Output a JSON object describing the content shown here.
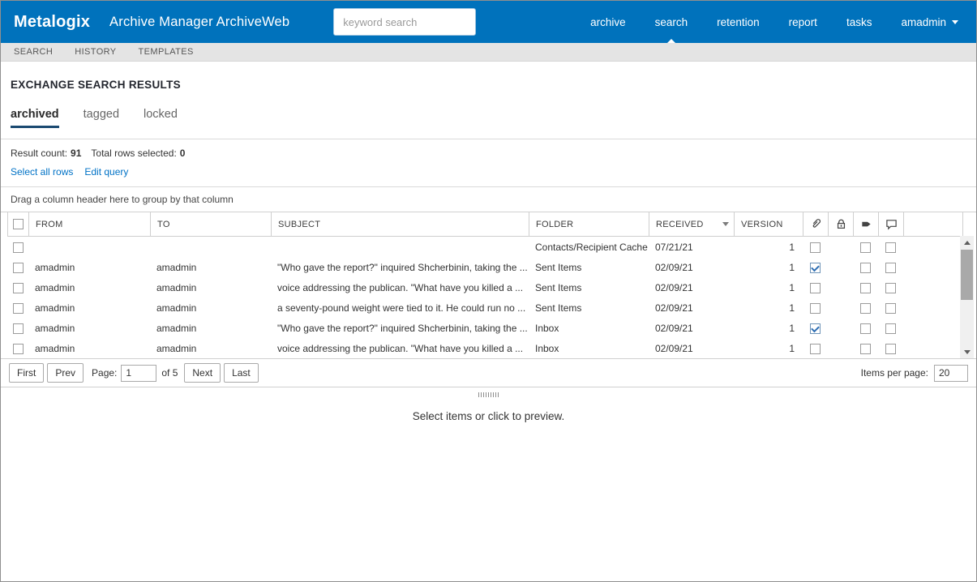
{
  "header": {
    "logo": "Metalogix",
    "app_title": "Archive Manager ArchiveWeb",
    "search": {
      "placeholder": "keyword search",
      "value": ""
    },
    "nav": [
      {
        "label": "archive",
        "active": false,
        "has_menu": false
      },
      {
        "label": "search",
        "active": true,
        "has_menu": false
      },
      {
        "label": "retention",
        "active": false,
        "has_menu": false
      },
      {
        "label": "report",
        "active": false,
        "has_menu": false
      },
      {
        "label": "tasks",
        "active": false,
        "has_menu": false
      },
      {
        "label": "amadmin",
        "active": false,
        "has_menu": true
      }
    ]
  },
  "subnav": {
    "items": [
      {
        "label": "SEARCH"
      },
      {
        "label": "HISTORY"
      },
      {
        "label": "TEMPLATES"
      }
    ]
  },
  "page": {
    "title": "EXCHANGE SEARCH RESULTS",
    "tabs": [
      {
        "label": "archived",
        "active": true
      },
      {
        "label": "tagged",
        "active": false
      },
      {
        "label": "locked",
        "active": false
      }
    ]
  },
  "results": {
    "result_count_label": "Result count:",
    "result_count": "91",
    "rows_selected_label": "Total rows selected:",
    "rows_selected": "0",
    "actions": [
      {
        "label": "Select all rows"
      },
      {
        "label": "Edit query"
      }
    ],
    "group_hint": "Drag a column header here to group by that column"
  },
  "table": {
    "columns": {
      "from": "FROM",
      "to": "TO",
      "subject": "SUBJECT",
      "folder": "FOLDER",
      "received": "RECEIVED",
      "version": "VERSION"
    },
    "icon_columns": [
      "paperclip-icon",
      "lock-icon",
      "tag-icon",
      "comment-icon"
    ],
    "rows": [
      {
        "from": "",
        "to": "",
        "subject": "",
        "folder": "Contacts/Recipient Cache",
        "received": "07/21/21",
        "version": "1",
        "attachment": false,
        "flag": false,
        "comment": false
      },
      {
        "from": "amadmin",
        "to": "amadmin",
        "subject": "\"Who gave the report?\" inquired Shcherbinin, taking the ...",
        "folder": "Sent Items",
        "received": "02/09/21",
        "version": "1",
        "attachment": true,
        "flag": false,
        "comment": false
      },
      {
        "from": "amadmin",
        "to": "amadmin",
        "subject": "voice addressing the publican. \"What have you killed a ...",
        "folder": "Sent Items",
        "received": "02/09/21",
        "version": "1",
        "attachment": false,
        "flag": false,
        "comment": false
      },
      {
        "from": "amadmin",
        "to": "amadmin",
        "subject": "a seventy-pound weight were tied to it. He could run no ...",
        "folder": "Sent Items",
        "received": "02/09/21",
        "version": "1",
        "attachment": false,
        "flag": false,
        "comment": false
      },
      {
        "from": "amadmin",
        "to": "amadmin",
        "subject": "\"Who gave the report?\" inquired Shcherbinin, taking the ...",
        "folder": "Inbox",
        "received": "02/09/21",
        "version": "1",
        "attachment": true,
        "flag": false,
        "comment": false
      },
      {
        "from": "amadmin",
        "to": "amadmin",
        "subject": "voice addressing the publican. \"What have you killed a ...",
        "folder": "Inbox",
        "received": "02/09/21",
        "version": "1",
        "attachment": false,
        "flag": false,
        "comment": false
      }
    ]
  },
  "pagination": {
    "first": "First",
    "prev": "Prev",
    "page_label": "Page:",
    "page_value": "1",
    "of_label": "of 5",
    "next": "Next",
    "last": "Last",
    "items_per_page_label": "Items per page:",
    "items_per_page_value": "20"
  },
  "preview": {
    "hint": "Select items or click to preview."
  },
  "colors": {
    "topbar": "#0072bc",
    "link": "#0072c6",
    "tab_underline": "#1b4a71",
    "check": "#2f6fb4"
  }
}
